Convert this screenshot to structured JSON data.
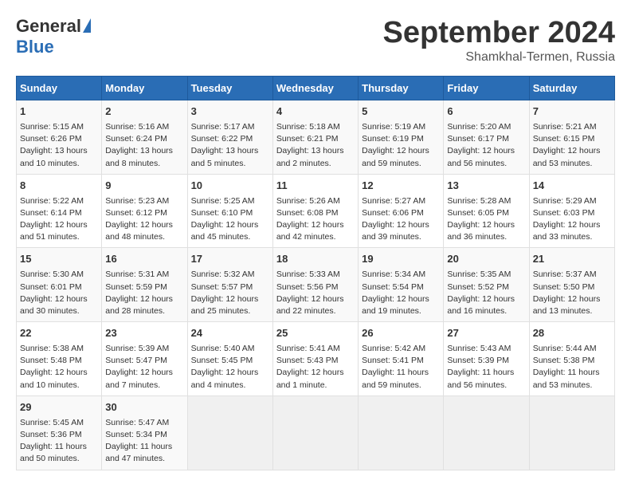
{
  "logo": {
    "general": "General",
    "blue": "Blue"
  },
  "title": "September 2024",
  "subtitle": "Shamkhal-Termen, Russia",
  "days_header": [
    "Sunday",
    "Monday",
    "Tuesday",
    "Wednesday",
    "Thursday",
    "Friday",
    "Saturday"
  ],
  "weeks": [
    [
      {
        "day": "1",
        "info": "Sunrise: 5:15 AM\nSunset: 6:26 PM\nDaylight: 13 hours and 10 minutes."
      },
      {
        "day": "2",
        "info": "Sunrise: 5:16 AM\nSunset: 6:24 PM\nDaylight: 13 hours and 8 minutes."
      },
      {
        "day": "3",
        "info": "Sunrise: 5:17 AM\nSunset: 6:22 PM\nDaylight: 13 hours and 5 minutes."
      },
      {
        "day": "4",
        "info": "Sunrise: 5:18 AM\nSunset: 6:21 PM\nDaylight: 13 hours and 2 minutes."
      },
      {
        "day": "5",
        "info": "Sunrise: 5:19 AM\nSunset: 6:19 PM\nDaylight: 12 hours and 59 minutes."
      },
      {
        "day": "6",
        "info": "Sunrise: 5:20 AM\nSunset: 6:17 PM\nDaylight: 12 hours and 56 minutes."
      },
      {
        "day": "7",
        "info": "Sunrise: 5:21 AM\nSunset: 6:15 PM\nDaylight: 12 hours and 53 minutes."
      }
    ],
    [
      {
        "day": "8",
        "info": "Sunrise: 5:22 AM\nSunset: 6:14 PM\nDaylight: 12 hours and 51 minutes."
      },
      {
        "day": "9",
        "info": "Sunrise: 5:23 AM\nSunset: 6:12 PM\nDaylight: 12 hours and 48 minutes."
      },
      {
        "day": "10",
        "info": "Sunrise: 5:25 AM\nSunset: 6:10 PM\nDaylight: 12 hours and 45 minutes."
      },
      {
        "day": "11",
        "info": "Sunrise: 5:26 AM\nSunset: 6:08 PM\nDaylight: 12 hours and 42 minutes."
      },
      {
        "day": "12",
        "info": "Sunrise: 5:27 AM\nSunset: 6:06 PM\nDaylight: 12 hours and 39 minutes."
      },
      {
        "day": "13",
        "info": "Sunrise: 5:28 AM\nSunset: 6:05 PM\nDaylight: 12 hours and 36 minutes."
      },
      {
        "day": "14",
        "info": "Sunrise: 5:29 AM\nSunset: 6:03 PM\nDaylight: 12 hours and 33 minutes."
      }
    ],
    [
      {
        "day": "15",
        "info": "Sunrise: 5:30 AM\nSunset: 6:01 PM\nDaylight: 12 hours and 30 minutes."
      },
      {
        "day": "16",
        "info": "Sunrise: 5:31 AM\nSunset: 5:59 PM\nDaylight: 12 hours and 28 minutes."
      },
      {
        "day": "17",
        "info": "Sunrise: 5:32 AM\nSunset: 5:57 PM\nDaylight: 12 hours and 25 minutes."
      },
      {
        "day": "18",
        "info": "Sunrise: 5:33 AM\nSunset: 5:56 PM\nDaylight: 12 hours and 22 minutes."
      },
      {
        "day": "19",
        "info": "Sunrise: 5:34 AM\nSunset: 5:54 PM\nDaylight: 12 hours and 19 minutes."
      },
      {
        "day": "20",
        "info": "Sunrise: 5:35 AM\nSunset: 5:52 PM\nDaylight: 12 hours and 16 minutes."
      },
      {
        "day": "21",
        "info": "Sunrise: 5:37 AM\nSunset: 5:50 PM\nDaylight: 12 hours and 13 minutes."
      }
    ],
    [
      {
        "day": "22",
        "info": "Sunrise: 5:38 AM\nSunset: 5:48 PM\nDaylight: 12 hours and 10 minutes."
      },
      {
        "day": "23",
        "info": "Sunrise: 5:39 AM\nSunset: 5:47 PM\nDaylight: 12 hours and 7 minutes."
      },
      {
        "day": "24",
        "info": "Sunrise: 5:40 AM\nSunset: 5:45 PM\nDaylight: 12 hours and 4 minutes."
      },
      {
        "day": "25",
        "info": "Sunrise: 5:41 AM\nSunset: 5:43 PM\nDaylight: 12 hours and 1 minute."
      },
      {
        "day": "26",
        "info": "Sunrise: 5:42 AM\nSunset: 5:41 PM\nDaylight: 11 hours and 59 minutes."
      },
      {
        "day": "27",
        "info": "Sunrise: 5:43 AM\nSunset: 5:39 PM\nDaylight: 11 hours and 56 minutes."
      },
      {
        "day": "28",
        "info": "Sunrise: 5:44 AM\nSunset: 5:38 PM\nDaylight: 11 hours and 53 minutes."
      }
    ],
    [
      {
        "day": "29",
        "info": "Sunrise: 5:45 AM\nSunset: 5:36 PM\nDaylight: 11 hours and 50 minutes."
      },
      {
        "day": "30",
        "info": "Sunrise: 5:47 AM\nSunset: 5:34 PM\nDaylight: 11 hours and 47 minutes."
      },
      {
        "day": "",
        "info": ""
      },
      {
        "day": "",
        "info": ""
      },
      {
        "day": "",
        "info": ""
      },
      {
        "day": "",
        "info": ""
      },
      {
        "day": "",
        "info": ""
      }
    ]
  ]
}
